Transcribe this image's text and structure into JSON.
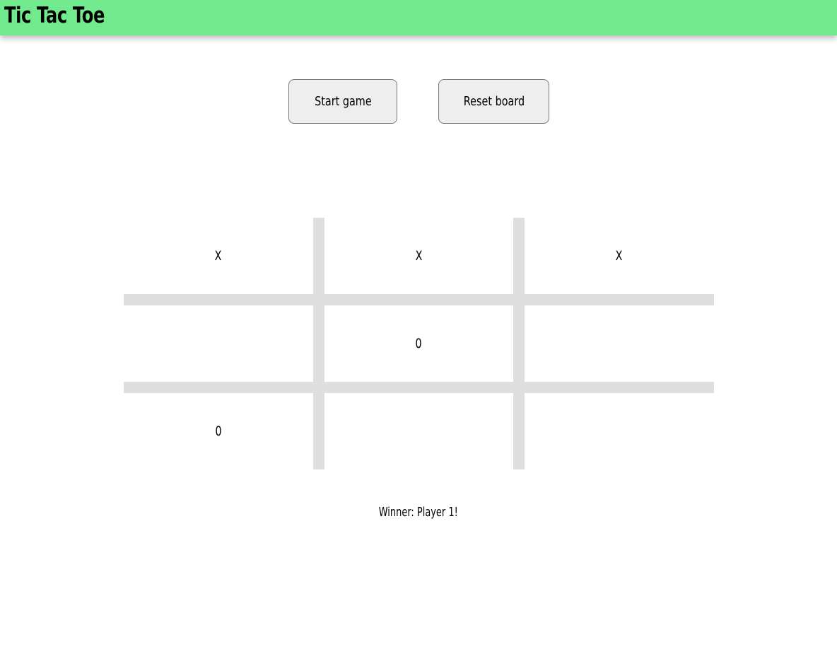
{
  "header": {
    "title": "Tic Tac Toe",
    "background_color": "#72ea8e"
  },
  "controls": {
    "start_label": "Start game",
    "reset_label": "Reset board"
  },
  "board": {
    "grid_line_color": "#e0dfdf",
    "cells": [
      "X",
      "X",
      "X",
      "",
      "0",
      "",
      "0",
      "",
      ""
    ]
  },
  "status": {
    "text": "Winner: Player 1!"
  }
}
